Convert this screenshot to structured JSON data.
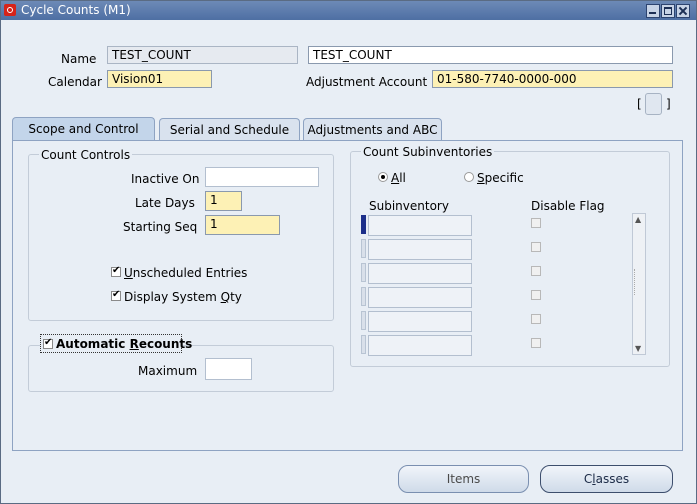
{
  "window": {
    "title": "Cycle Counts (M1)"
  },
  "header": {
    "name_label": "Name",
    "name_value": "TEST_COUNT",
    "description_value": "TEST_COUNT",
    "calendar_label": "Calendar",
    "calendar_value": "Vision01",
    "adjustment_label": "Adjustment Account",
    "adjustment_value": "01-580-7740-0000-000",
    "bracket_left": "[",
    "bracket_right": "]"
  },
  "tabs": [
    {
      "label": "Scope and Control",
      "active": true
    },
    {
      "label": "Serial and Schedule",
      "active": false
    },
    {
      "label": "Adjustments and ABC",
      "active": false
    }
  ],
  "count_controls": {
    "title": "Count Controls",
    "inactive_on_label": "Inactive On",
    "inactive_on_value": "",
    "late_days_label": "Late Days",
    "late_days_value": "1",
    "starting_seq_label": "Starting Seq",
    "starting_seq_value": "1",
    "unscheduled_label_u": "U",
    "unscheduled_label_rest": "nscheduled Entries",
    "unscheduled_checked": true,
    "display_qty_label_pre": "Display System ",
    "display_qty_label_u": "Q",
    "display_qty_label_rest": "ty",
    "display_qty_checked": true
  },
  "recounts": {
    "label_pre": "Automatic ",
    "label_u": "R",
    "label_rest": "ecounts",
    "checked": true,
    "maximum_label": "Maximum",
    "maximum_value": ""
  },
  "subinventories": {
    "title": "Count Subinventories",
    "all_label_u": "A",
    "all_label_rest": "ll",
    "specific_label_u": "S",
    "specific_label_rest": "pecific",
    "selected": "All",
    "col_subinventory": "Subinventory",
    "col_disable": "Disable Flag",
    "rows": [
      "",
      "",
      "",
      "",
      "",
      ""
    ]
  },
  "buttons": {
    "items": "Items",
    "classes_pre": "C",
    "classes_u": "l",
    "classes_rest": "asses"
  }
}
